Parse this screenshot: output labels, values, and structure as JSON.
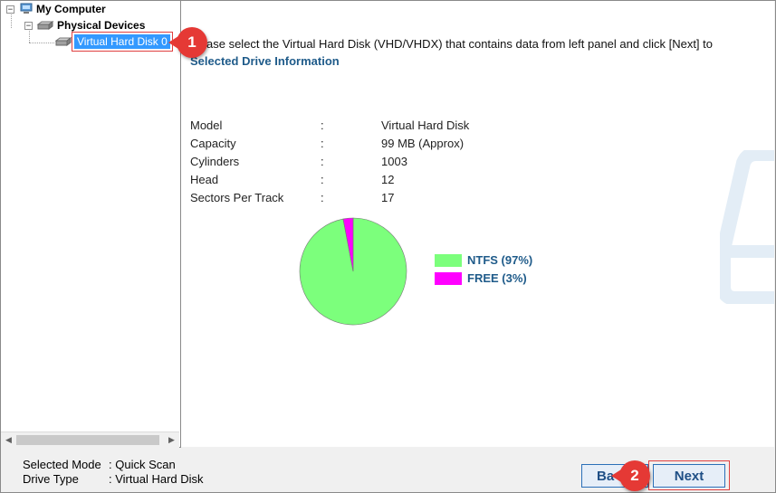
{
  "tree": {
    "root_label": "My Computer",
    "group_label": "Physical Devices",
    "selected_disk_label": "Virtual Hard Disk 0"
  },
  "instruction_text": "ase select the Virtual Hard Disk (VHD/VHDX) that contains data from left panel and click [Next] to",
  "section_title": "Selected Drive Information",
  "drive_info": [
    {
      "label": "Model",
      "sep": ":",
      "value": "Virtual Hard Disk"
    },
    {
      "label": "Capacity",
      "sep": ":",
      "value": "99 MB (Approx)"
    },
    {
      "label": "Cylinders",
      "sep": ":",
      "value": "1003"
    },
    {
      "label": "Head",
      "sep": ":",
      "value": "12"
    },
    {
      "label": "Sectors Per Track",
      "sep": ":",
      "value": "17"
    }
  ],
  "chart_data": {
    "type": "pie",
    "series": [
      {
        "name": "NTFS (97%)",
        "value": 97,
        "color": "#7cff7c"
      },
      {
        "name": "FREE (3%)",
        "value": 3,
        "color": "#ff00ff"
      }
    ]
  },
  "status": {
    "mode_key": "Selected Mode",
    "mode_value": ": Quick Scan",
    "type_key": "Drive Type",
    "type_value": ": Virtual Hard Disk"
  },
  "buttons": {
    "back_label": "Ba",
    "next_label": "Next"
  },
  "callouts": {
    "first": "1",
    "second": "2"
  },
  "colors": {
    "accent": "#1f5b8a",
    "selection": "#3399ff",
    "callout": "#e53935"
  }
}
